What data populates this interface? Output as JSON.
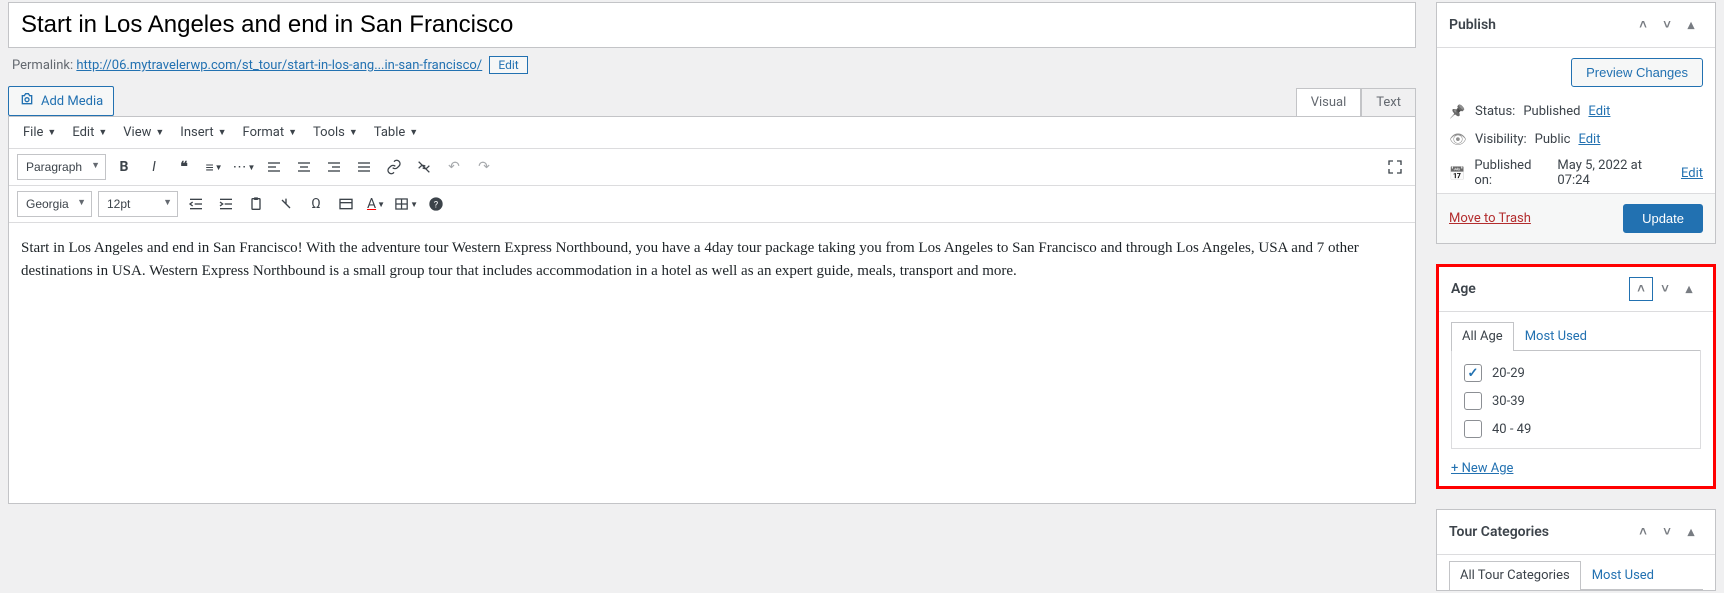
{
  "title": "Start in Los Angeles and end in San Francisco",
  "permalink": {
    "label": "Permalink:",
    "base": "http://06.mytravelerwp.com/st_tour/",
    "slug": "start-in-los-ang...in-san-francisco/",
    "edit_label": "Edit"
  },
  "media": {
    "add_label": "Add Media"
  },
  "editor_tabs": {
    "visual": "Visual",
    "text": "Text"
  },
  "menubar": {
    "file": "File",
    "edit": "Edit",
    "view": "View",
    "insert": "Insert",
    "format": "Format",
    "tools": "Tools",
    "table": "Table"
  },
  "toolbar": {
    "paragraph": "Paragraph",
    "font": "Georgia",
    "size": "12pt"
  },
  "content": "Start in Los Angeles and end in San Francisco! With the adventure tour Western Express Northbound, you have a 4day tour package taking you from Los Angeles to San Francisco and through Los Angeles, USA and 7 other destinations in USA. Western Express Northbound is a small group tour that includes accommodation in a hotel as well as an expert guide, meals, transport and more.",
  "publish": {
    "title": "Publish",
    "preview": "Preview Changes",
    "status_label": "Status:",
    "status_value": "Published",
    "visibility_label": "Visibility:",
    "visibility_value": "Public",
    "date_label": "Published on:",
    "date_value": "May 5, 2022 at 07:24",
    "edit": "Edit",
    "trash": "Move to Trash",
    "update": "Update"
  },
  "age": {
    "title": "Age",
    "tabs": {
      "all": "All Age",
      "most": "Most Used"
    },
    "items": [
      {
        "label": "20-29",
        "checked": true
      },
      {
        "label": "30-39",
        "checked": false
      },
      {
        "label": "40 - 49",
        "checked": false
      }
    ],
    "add_new": "+ New Age"
  },
  "tour_categories": {
    "title": "Tour Categories",
    "tabs": {
      "all": "All Tour Categories",
      "most": "Most Used"
    }
  }
}
